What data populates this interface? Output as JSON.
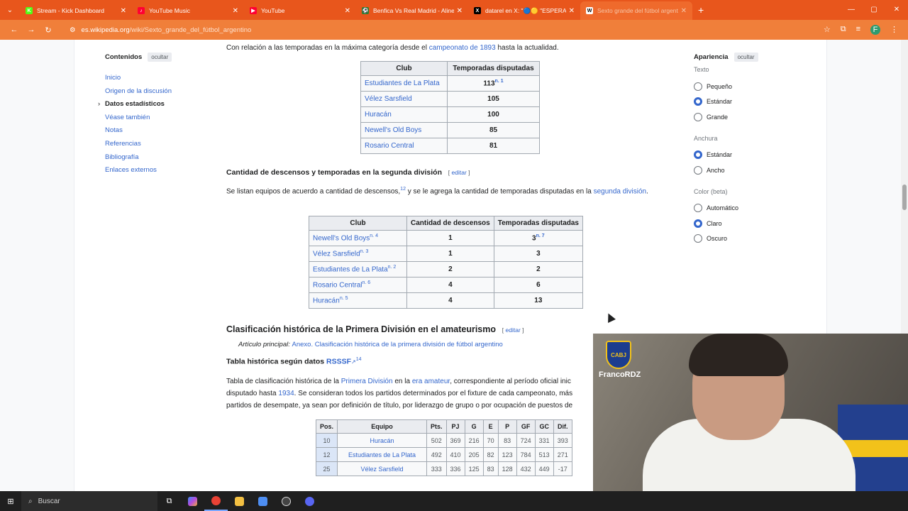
{
  "browser": {
    "tabs": [
      {
        "title": "Stream - Kick Dashboard",
        "color": "#53fc18",
        "glyph": "K"
      },
      {
        "title": "YouTube Music",
        "color": "#ff0033",
        "glyph": "♪"
      },
      {
        "title": "YouTube",
        "color": "#ff0033",
        "glyph": "▶"
      },
      {
        "title": "Benfica Vs Real Madrid - Alinea",
        "color": "#2e7d32",
        "glyph": "⚽"
      },
      {
        "title": "datarel en X: \"🔵🟡 \"ESPERAM",
        "color": "#000000",
        "glyph": "X"
      },
      {
        "title": "Sexto grande del fútbol argentin",
        "color": "#ffffff",
        "glyph": "W"
      }
    ],
    "url_domain": "es.wikipedia.org",
    "url_path": "/wiki/Sexto_grande_del_fútbol_argentino",
    "profile_initial": "F"
  },
  "toc": {
    "title": "Contenidos",
    "hide": "ocultar",
    "items": [
      "Inicio",
      "Origen de la discusión",
      "Datos estadísticos",
      "Véase también",
      "Notas",
      "Referencias",
      "Bibliografía",
      "Enlaces externos"
    ]
  },
  "content": {
    "intro_pre": "Con relación a las temporadas en la máxima categoría desde el ",
    "intro_link": "campeonato de 1893",
    "intro_post": " hasta la actualidad.",
    "table1": {
      "headers": [
        "Club",
        "Temporadas disputadas"
      ],
      "rows": [
        {
          "club": "Estudiantes de La Plata",
          "value": "113",
          "note": "n. 1"
        },
        {
          "club": "Vélez Sarsfield",
          "value": "105",
          "note": ""
        },
        {
          "club": "Huracán",
          "value": "100",
          "note": ""
        },
        {
          "club": "Newell's Old Boys",
          "value": "85",
          "note": ""
        },
        {
          "club": "Rosario Central",
          "value": "81",
          "note": ""
        }
      ]
    },
    "section2_title": "Cantidad de descensos y temporadas en la segunda división",
    "edit_label": "editar",
    "section2_text_pre": "Se listan equipos de acuerdo a cantidad de descensos,",
    "section2_ref": "12",
    "section2_text_mid": " y se le agrega la cantidad de temporadas disputadas en la ",
    "section2_link": "segunda división",
    "section2_text_post": ".",
    "table2": {
      "headers": [
        "Club",
        "Cantidad de descensos",
        "Temporadas disputadas"
      ],
      "rows": [
        {
          "club": "Newell's Old Boys",
          "note": "n. 4",
          "descensos": "1",
          "temporadas": "3",
          "tnote": "n. 7"
        },
        {
          "club": "Vélez Sarsfield",
          "note": "n. 3",
          "descensos": "1",
          "temporadas": "3",
          "tnote": ""
        },
        {
          "club": "Estudiantes de La Plata",
          "note": "n. 2",
          "descensos": "2",
          "temporadas": "2",
          "tnote": ""
        },
        {
          "club": "Rosario Central",
          "note": "n. 6",
          "descensos": "4",
          "temporadas": "6",
          "tnote": ""
        },
        {
          "club": "Huracán",
          "note": "n. 5",
          "descensos": "4",
          "temporadas": "13",
          "tnote": ""
        }
      ]
    },
    "section3_title": "Clasificación histórica de la Primera División en el amateurismo",
    "main_article_label": "Artículo principal: ",
    "main_article_link": "Anexo. Clasificación histórica de la primera división de fútbol argentino",
    "sub_title": "Tabla histórica según datos ",
    "sub_link": "RSSSF",
    "sub_ref": "14",
    "para3_a": "Tabla de clasificación histórica de la ",
    "para3_link1": "Primera División",
    "para3_b": " en la ",
    "para3_link2": "era amateur",
    "para3_c": ", correspondiente al período oficial inic",
    "para3_d": "disputado hasta ",
    "para3_link3": "1934",
    "para3_e": ". Se consideran todos los partidos determinados por el fixture de cada campeonato, más",
    "para3_f": "partidos de desempate, ya sean por definición de título, por liderazgo de grupo o por ocupación de puestos de",
    "table3": {
      "headers": [
        "Pos.",
        "Equipo",
        "Pts.",
        "PJ",
        "G",
        "E",
        "P",
        "GF",
        "GC",
        "Dif."
      ],
      "rows": [
        [
          "10",
          "Huracán",
          "502",
          "369",
          "216",
          "70",
          "83",
          "724",
          "331",
          "393"
        ],
        [
          "12",
          "Estudiantes de La Plata",
          "492",
          "410",
          "205",
          "82",
          "123",
          "784",
          "513",
          "271"
        ],
        [
          "25",
          "Vélez Sarsfield",
          "333",
          "336",
          "125",
          "83",
          "128",
          "432",
          "449",
          "-17"
        ]
      ]
    }
  },
  "appearance": {
    "title": "Apariencia",
    "hide": "ocultar",
    "groups": [
      {
        "label": "Texto",
        "options": [
          {
            "label": "Pequeño",
            "on": false
          },
          {
            "label": "Estándar",
            "on": true
          },
          {
            "label": "Grande",
            "on": false
          }
        ]
      },
      {
        "label": "Anchura",
        "options": [
          {
            "label": "Estándar",
            "on": true
          },
          {
            "label": "Ancho",
            "on": false
          }
        ]
      },
      {
        "label": "Color (beta)",
        "options": [
          {
            "label": "Automático",
            "on": false
          },
          {
            "label": "Claro",
            "on": true
          },
          {
            "label": "Oscuro",
            "on": false
          }
        ]
      }
    ]
  },
  "webcam": {
    "username": "FrancoRDZ",
    "badge": "CABJ"
  },
  "taskbar": {
    "search_placeholder": "Buscar"
  }
}
